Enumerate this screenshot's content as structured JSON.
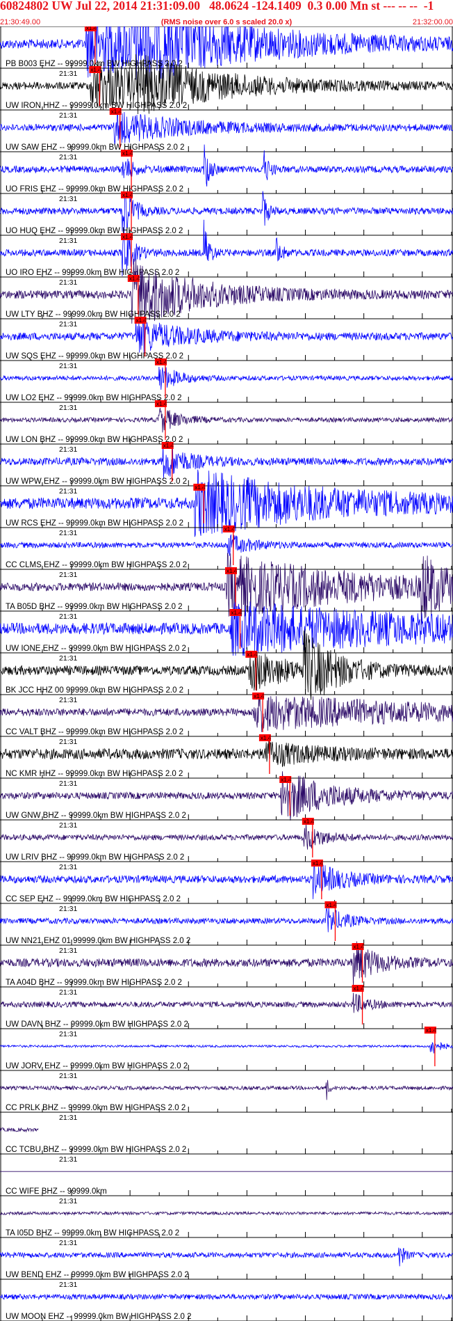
{
  "header": {
    "title": "60824802 UW Jul 22, 2014 21:31:09.00   48.0624 -124.1409  0.3 0.00 Mn st --- -- --  -1",
    "start_time": "21:30:49.00",
    "note": "(RMS noise over 6.0 s scaled 20.0 x)",
    "end_time": "21:32:00.00"
  },
  "colors": {
    "header_text": "#e8141c",
    "pick_box": "#ff0000",
    "pick_line": "#ff0000",
    "blue_trace": "#0000ff",
    "purple_trace": "#2a0866",
    "black_trace": "#000000",
    "axis": "#000000"
  },
  "time_label": "21:31",
  "pick_label": "x1.4",
  "traces": [
    {
      "label": "PB B003 EHZ -- 99999.0km BW  HIGHPASS  2.0  2",
      "color": "blue",
      "amp": 0.25,
      "pick": 0.19,
      "bursts": [
        [
          0.19,
          0.9,
          0.3
        ],
        [
          0.3,
          0.55,
          0.2
        ]
      ]
    },
    {
      "label": "UW IRON HHZ -- 99999.0km BW  HIGHPASS  2.0  2",
      "color": "black",
      "amp": 0.2,
      "pick": 0.2,
      "bursts": [
        [
          0.2,
          0.8,
          0.15
        ],
        [
          0.3,
          0.5,
          0.2
        ]
      ]
    },
    {
      "label": "UW SAW EHZ -- 99999.0km BW  HIGHPASS  2.0  2",
      "color": "blue",
      "amp": 0.18,
      "pick": 0.245,
      "bursts": [
        [
          0.25,
          0.45,
          0.15
        ]
      ]
    },
    {
      "label": "UO FRIS EHZ -- 99999.0km BW  HIGHPASS  2.0  2",
      "color": "blue",
      "amp": 0.18,
      "pick": 0.27,
      "bursts": [
        [
          0.27,
          0.4,
          0.02
        ],
        [
          0.45,
          1.0,
          0.01
        ],
        [
          0.58,
          0.7,
          0.01
        ]
      ]
    },
    {
      "label": "UO HUQ EHZ -- 99999.0km BW  HIGHPASS  2.0  2",
      "color": "blue",
      "amp": 0.18,
      "pick": 0.27,
      "bursts": [
        [
          0.27,
          0.9,
          0.02
        ],
        [
          0.58,
          0.6,
          0.01
        ]
      ]
    },
    {
      "label": "UO IRO EHZ -- 99999.0km BW  HIGHPASS  2.0  2",
      "color": "blue",
      "amp": 0.18,
      "pick": 0.27,
      "bursts": [
        [
          0.27,
          0.9,
          0.02
        ],
        [
          0.45,
          1.0,
          0.01
        ],
        [
          0.61,
          0.5,
          0.01
        ]
      ]
    },
    {
      "label": "UW LTY BHZ -- 99999.0km BW  HIGHPASS  2.0  2",
      "color": "purple",
      "amp": 0.22,
      "pick": 0.285,
      "bursts": [
        [
          0.29,
          1.0,
          0.14
        ]
      ]
    },
    {
      "label": "UW SQS EHZ -- 99999.0km BW  HIGHPASS  2.0  2",
      "color": "blue",
      "amp": 0.2,
      "pick": 0.3,
      "bursts": [
        [
          0.3,
          0.5,
          0.1
        ]
      ]
    },
    {
      "label": "UW LO2 EHZ -- 99999.0km BW  HIGHPASS  2.0  2",
      "color": "blue",
      "amp": 0.12,
      "pick": 0.345,
      "bursts": [
        [
          0.35,
          0.4,
          0.04
        ]
      ]
    },
    {
      "label": "UW LON BHZ -- 99999.0km BW  HIGHPASS  2.0  2",
      "color": "purple",
      "amp": 0.12,
      "pick": 0.345,
      "bursts": [
        [
          0.35,
          0.4,
          0.04
        ]
      ]
    },
    {
      "label": "UW WPW EHZ -- 99999.0km BW  HIGHPASS  2.0  2",
      "color": "blue",
      "amp": 0.2,
      "pick": 0.36,
      "bursts": [
        [
          0.36,
          0.5,
          0.05
        ]
      ]
    },
    {
      "label": "UW RCS EHZ -- 99999.0km BW  HIGHPASS  2.0  2",
      "color": "blue",
      "amp": 0.3,
      "pick": 0.43,
      "bursts": [
        [
          0.43,
          0.9,
          0.3
        ]
      ]
    },
    {
      "label": "CC CLMS EHZ -- 99999.0km BW  HIGHPASS  2.0  2",
      "color": "blue",
      "amp": 0.15,
      "pick": 0.495,
      "bursts": [
        [
          0.5,
          0.3,
          0.05
        ]
      ]
    },
    {
      "label": "TA B05D BHZ -- 99999.0km BW  HIGHPASS  2.0  2",
      "color": "purple",
      "amp": 0.22,
      "pick": 0.5,
      "bursts": [
        [
          0.5,
          0.9,
          0.3
        ],
        [
          0.93,
          0.9,
          0.05
        ]
      ]
    },
    {
      "label": "UW IONE EHZ -- 99999.0km BW  HIGHPASS  2.0  2",
      "color": "blue",
      "amp": 0.3,
      "pick": 0.51,
      "bursts": [
        [
          0.51,
          0.7,
          0.5
        ]
      ]
    },
    {
      "label": "BK JCC HHZ 00 99999.0km BW  HIGHPASS  2.0  2",
      "color": "black",
      "amp": 0.25,
      "pick": 0.545,
      "bursts": [
        [
          0.55,
          0.6,
          0.08
        ],
        [
          0.67,
          1.0,
          0.07
        ]
      ]
    },
    {
      "label": "CC VALT BHZ -- 99999.0km BW  HIGHPASS  2.0  2",
      "color": "purple",
      "amp": 0.2,
      "pick": 0.56,
      "bursts": [
        [
          0.56,
          0.5,
          0.4
        ]
      ]
    },
    {
      "label": "NC KMR HHZ -- 99999.0km BW  HIGHPASS  2.0  2",
      "color": "black",
      "amp": 0.28,
      "pick": 0.575,
      "bursts": [
        [
          0.58,
          0.35,
          0.1
        ]
      ]
    },
    {
      "label": "UW GNW BHZ -- 99999.0km BW  HIGHPASS  2.0  2",
      "color": "purple",
      "amp": 0.18,
      "pick": 0.62,
      "bursts": [
        [
          0.62,
          0.8,
          0.1
        ]
      ]
    },
    {
      "label": "UW LRIV BHZ -- 99999.0km BW  HIGHPASS  2.0  2",
      "color": "purple",
      "amp": 0.15,
      "pick": 0.67,
      "bursts": [
        [
          0.67,
          0.4,
          0.04
        ]
      ]
    },
    {
      "label": "CC SEP EHZ -- 99999.0km BW  HIGHPASS  2.0  2",
      "color": "blue",
      "amp": 0.2,
      "pick": 0.69,
      "bursts": [
        [
          0.69,
          0.5,
          0.06
        ]
      ]
    },
    {
      "label": "UW NN21 EHZ 01 99999.0km BW  HIGHPASS  2.0  2",
      "color": "blue",
      "amp": 0.15,
      "pick": 0.72,
      "bursts": [
        [
          0.72,
          0.4,
          0.04
        ]
      ]
    },
    {
      "label": "TA A04D BHZ -- 99999.0km BW  HIGHPASS  2.0  2",
      "color": "purple",
      "amp": 0.22,
      "pick": 0.78,
      "bursts": [
        [
          0.78,
          0.6,
          0.05
        ]
      ]
    },
    {
      "label": "UW DAVN BHZ -- 99999.0km BW  HIGHPASS  2.0  2",
      "color": "purple",
      "amp": 0.15,
      "pick": 0.78,
      "bursts": [
        [
          0.78,
          0.3,
          0.03
        ]
      ]
    },
    {
      "label": "UW JORV EHZ -- 99999.0km BW  HIGHPASS  2.0  2",
      "color": "blue",
      "amp": 0.06,
      "pick": 0.94,
      "bursts": [
        [
          0.95,
          0.3,
          0.02
        ]
      ]
    },
    {
      "label": "CC PRLK BHZ -- 99999.0km BW  HIGHPASS  2.0  2",
      "color": "purple",
      "amp": 0.1,
      "pick": null,
      "bursts": [
        [
          0.72,
          0.4,
          0.005
        ]
      ]
    },
    {
      "label": "CC TCBU BHZ -- 99999.0km BW  HIGHPASS  2.0  2",
      "color": "purple",
      "amp": 0.1,
      "pick": null,
      "bursts": [],
      "cut": 0.085
    },
    {
      "label": "CC WIFE BHZ -- 99999.0km",
      "color": "purple",
      "amp": 0.0,
      "pick": null,
      "bursts": []
    },
    {
      "label": "TA I05D BHZ -- 99999.0km BW  HIGHPASS  2.0  2",
      "color": "purple",
      "amp": 0.08,
      "pick": null,
      "bursts": []
    },
    {
      "label": "UW BEND EHZ -- 99999.0km BW  HIGHPASS  2.0  2",
      "color": "blue",
      "amp": 0.14,
      "pick": null,
      "bursts": [
        [
          0.88,
          0.4,
          0.01
        ]
      ]
    },
    {
      "label": "UW MOON EHZ -- 99999.0km BW  HIGHPASS  2.0  2",
      "color": "blue",
      "amp": 0.14,
      "pick": null,
      "bursts": []
    }
  ]
}
